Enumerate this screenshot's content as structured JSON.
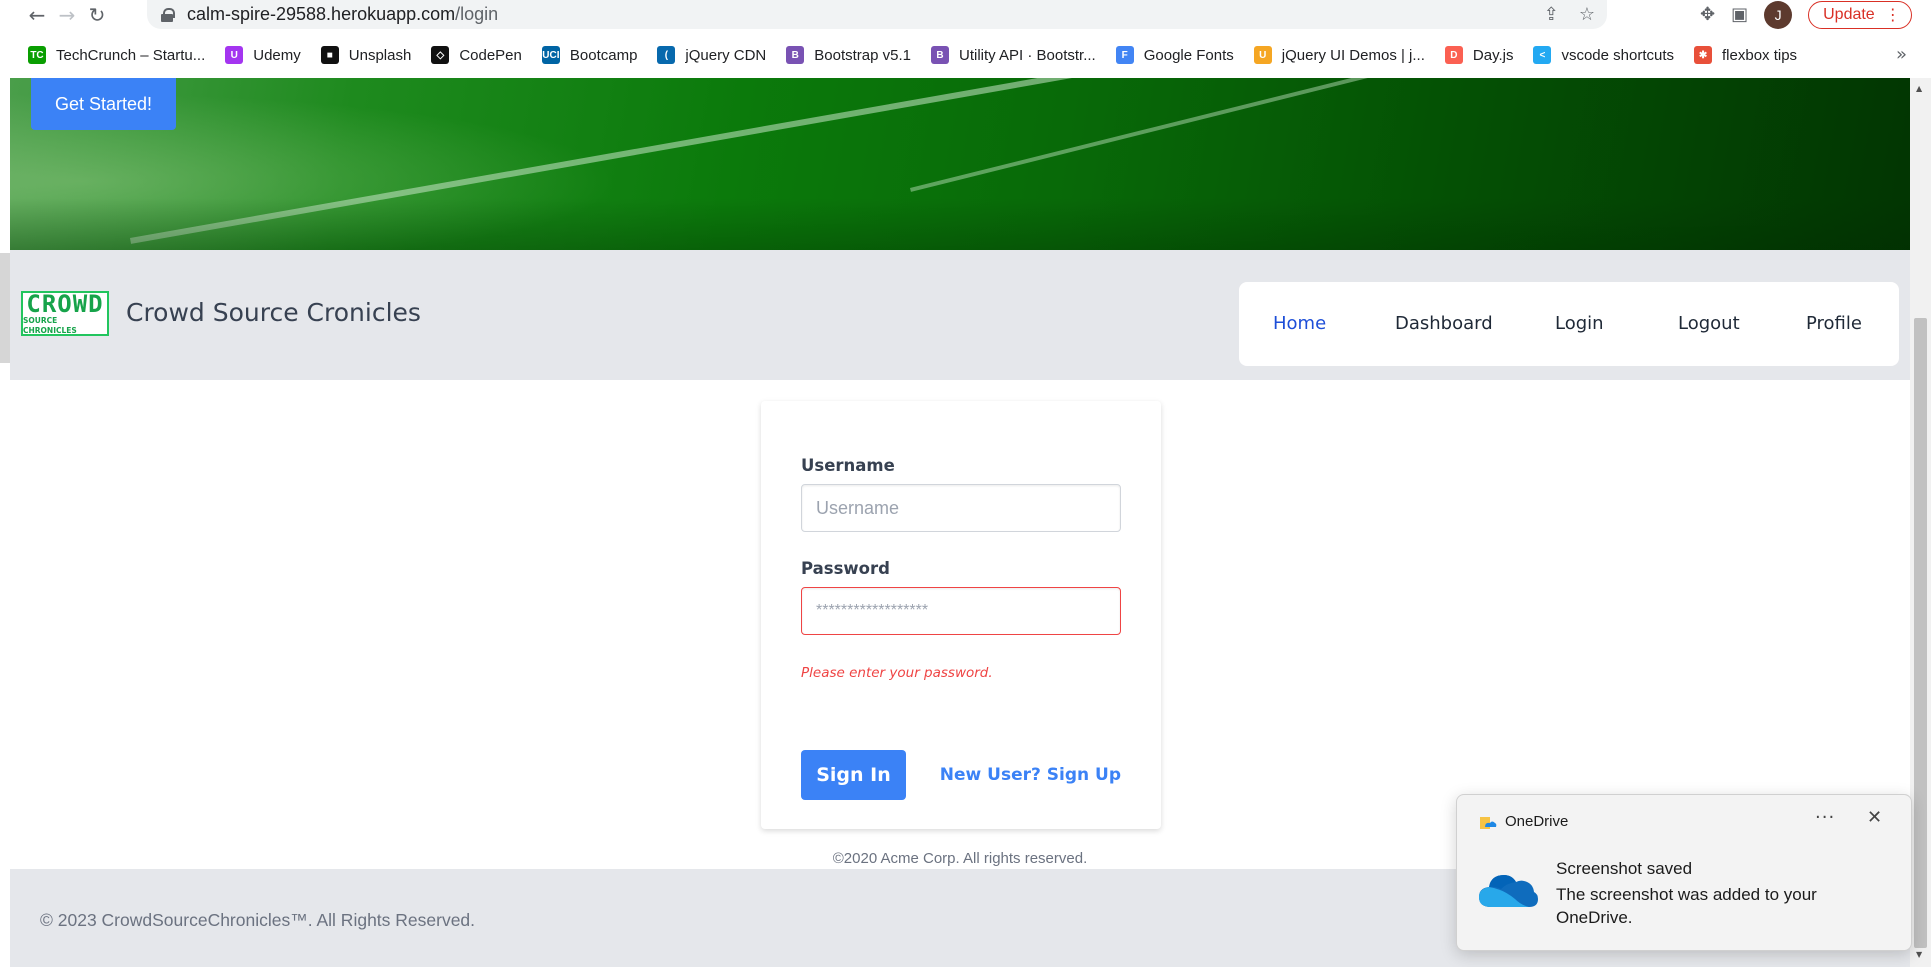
{
  "browser": {
    "url_host": "calm-spire-29588.herokuapp.com",
    "url_path": "/login",
    "avatar_letter": "J",
    "update_label": "Update"
  },
  "bookmarks": [
    {
      "label": "TechCrunch – Startu...",
      "icon": "techcrunch-icon",
      "color": "#0a9e01",
      "glyph": "TC"
    },
    {
      "label": "Udemy",
      "icon": "udemy-icon",
      "color": "#a435f0",
      "glyph": "U"
    },
    {
      "label": "Unsplash",
      "icon": "unsplash-icon",
      "color": "#111111",
      "glyph": "■"
    },
    {
      "label": "CodePen",
      "icon": "codepen-icon",
      "color": "#111111",
      "glyph": "◇"
    },
    {
      "label": "Bootcamp",
      "icon": "uci-icon",
      "color": "#0064a4",
      "glyph": "UCI"
    },
    {
      "label": "jQuery CDN",
      "icon": "jquery-icon",
      "color": "#0769ad",
      "glyph": "("
    },
    {
      "label": "Bootstrap v5.1",
      "icon": "bootstrap-icon",
      "color": "#7952b3",
      "glyph": "B"
    },
    {
      "label": "Utility API · Bootstr...",
      "icon": "bootstrap-icon",
      "color": "#7952b3",
      "glyph": "B"
    },
    {
      "label": "Google Fonts",
      "icon": "google-fonts-icon",
      "color": "#4285f4",
      "glyph": "F"
    },
    {
      "label": "jQuery UI Demos | j...",
      "icon": "jquery-ui-icon",
      "color": "#f5a623",
      "glyph": "U"
    },
    {
      "label": "Day.js",
      "icon": "dayjs-icon",
      "color": "#fb6052",
      "glyph": "D"
    },
    {
      "label": "vscode shortcuts",
      "icon": "vscode-icon",
      "color": "#23a9f2",
      "glyph": "<"
    },
    {
      "label": "flexbox tips",
      "icon": "asterisk-icon",
      "color": "#e8503a",
      "glyph": "✱"
    }
  ],
  "hero": {
    "cta": "Get Started!"
  },
  "navbar": {
    "logo_big": "CROWD",
    "logo_small": "SOURCE CHRONICLES",
    "site_title": "Crowd Source Cronicles",
    "links": [
      "Home",
      "Dashboard",
      "Login",
      "Logout",
      "Profile"
    ]
  },
  "login": {
    "username_label": "Username",
    "username_placeholder": "Username",
    "password_label": "Password",
    "password_placeholder": "******************",
    "password_error": "Please enter your password.",
    "submit": "Sign In",
    "signup_link": "New User? Sign Up",
    "copyright": "©2020 Acme Corp. All rights reserved."
  },
  "footer": {
    "text": "© 2023 CrowdSourceChronicles™. All Rights Reserved."
  },
  "toast": {
    "app_name": "OneDrive",
    "title": "Screenshot saved",
    "body": "The screenshot was added to your OneDrive."
  },
  "colors": {
    "accent": "#3b82f6",
    "error": "#ef4444",
    "active_link": "#1d4ed8"
  }
}
